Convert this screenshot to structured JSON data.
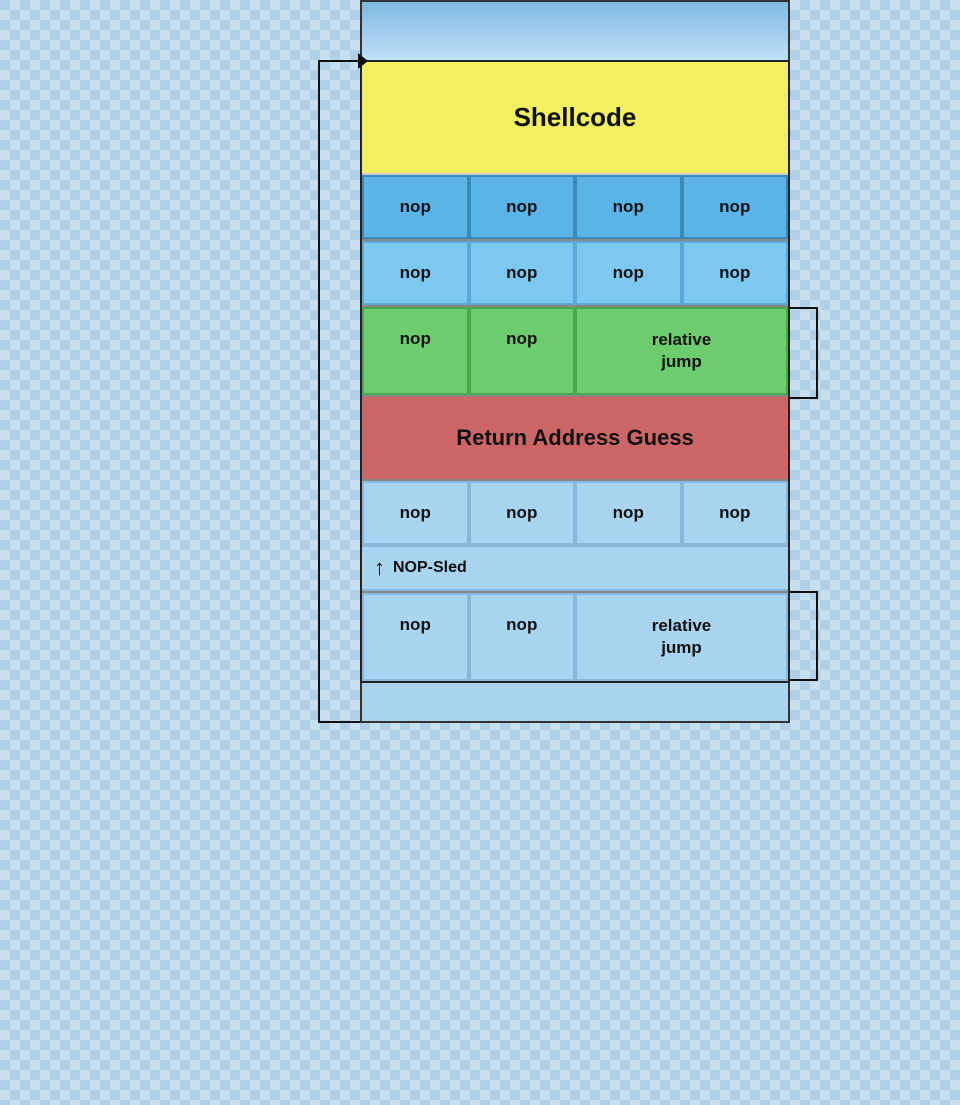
{
  "diagram": {
    "shellcode": {
      "label": "Shellcode"
    },
    "nop_rows": [
      [
        "nop",
        "nop",
        "nop",
        "nop"
      ],
      [
        "nop",
        "nop",
        "nop",
        "nop"
      ]
    ],
    "green_row": {
      "cells": [
        "nop",
        "nop"
      ],
      "jump_label": "relative\njump"
    },
    "return_address": {
      "label": "Return Address Guess"
    },
    "nop_sled_row": {
      "cells": [
        "nop",
        "nop",
        "nop",
        "nop"
      ],
      "label": "NOP-Sled"
    },
    "bottom_row": {
      "cells": [
        "nop",
        "nop"
      ],
      "jump_label": "relative\njump"
    }
  }
}
